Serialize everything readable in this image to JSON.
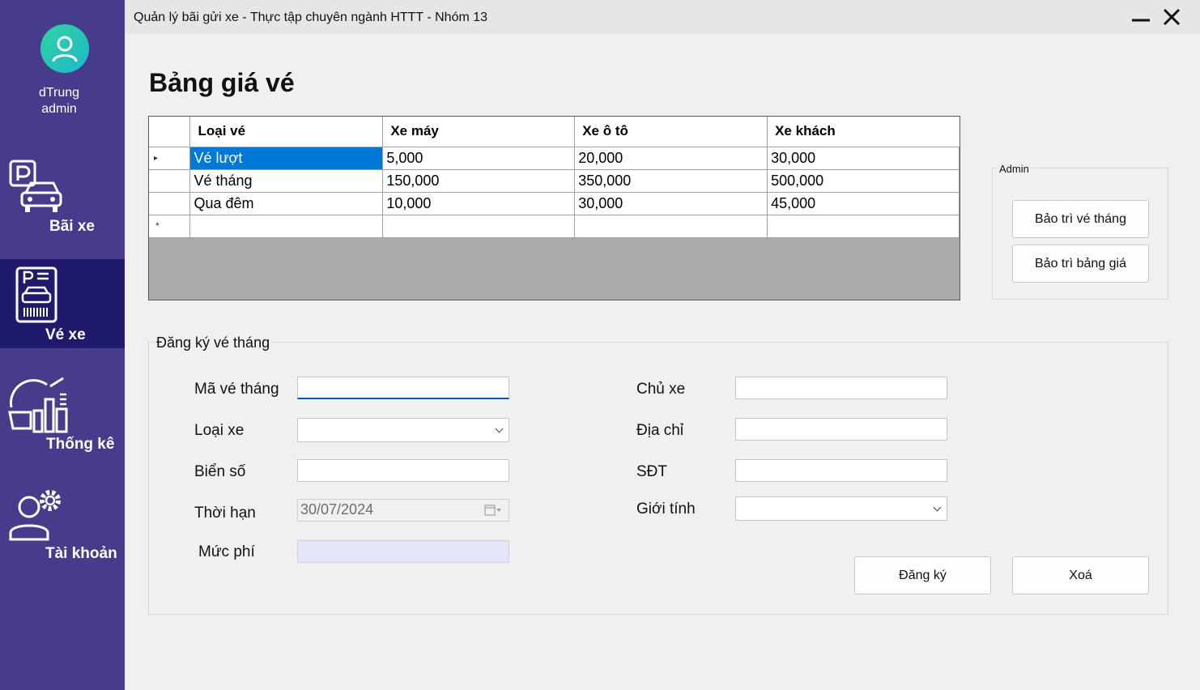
{
  "window": {
    "title": "Quản lý bãi gửi xe - Thực tập chuyên ngành HTTT - Nhóm 13"
  },
  "user": {
    "name": "dTrung",
    "role": "admin"
  },
  "sidebar": {
    "items": [
      {
        "label": "Bãi xe",
        "icon": "parking-car-icon"
      },
      {
        "label": "Vé xe",
        "icon": "ticket-icon",
        "active": true
      },
      {
        "label": "Thống kê",
        "icon": "statistics-icon"
      },
      {
        "label": "Tài khoản",
        "icon": "account-settings-icon"
      }
    ]
  },
  "page": {
    "title": "Bảng giá vé"
  },
  "price_table": {
    "columns": [
      "Loại vé",
      "Xe máy",
      "Xe ô tô",
      "Xe khách"
    ],
    "rows": [
      [
        "Vé lượt",
        "5,000",
        "20,000",
        "30,000"
      ],
      [
        "Vé tháng",
        "150,000",
        "350,000",
        "500,000"
      ],
      [
        "Qua đêm",
        "10,000",
        "30,000",
        "45,000"
      ]
    ],
    "current_row_marker": "▸",
    "new_row_marker": "*"
  },
  "admin_group": {
    "label": "Admin",
    "maintain_monthly_label": "Bảo trì vé tháng",
    "maintain_prices_label": "Bảo trì bảng giá"
  },
  "register_form": {
    "label": "Đăng ký vé tháng",
    "ticket_id_label": "Mã vé tháng",
    "ticket_id_value": "",
    "vehicle_type_label": "Loại xe",
    "vehicle_type_value": "",
    "plate_label": "Biển số",
    "plate_value": "",
    "duration_label": "Thời hạn",
    "duration_value": "30/07/2024",
    "fee_label": "Mức phí",
    "fee_value": "",
    "owner_label": "Chủ xe",
    "owner_value": "",
    "address_label": "Địa chỉ",
    "address_value": "",
    "phone_label": "SĐT",
    "phone_value": "",
    "gender_label": "Giới tính",
    "gender_value": "",
    "register_label": "Đăng ký",
    "delete_label": "Xoá"
  }
}
